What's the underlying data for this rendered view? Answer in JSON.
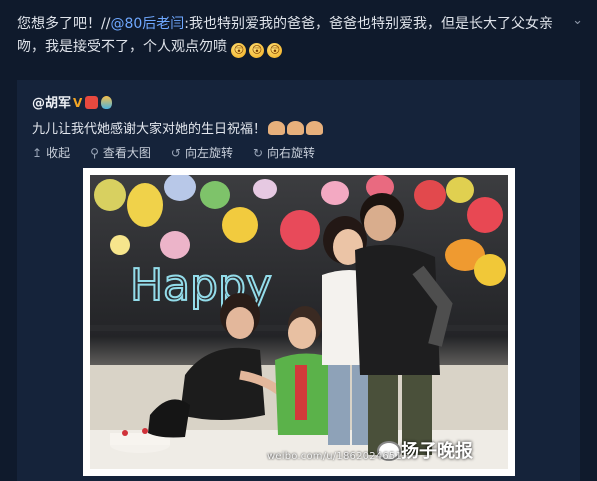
{
  "post": {
    "text_before": "您想多了吧！//",
    "mention": "@80后老闫",
    "text_after": ":我也特别爱我的爸爸，爸爸也特别爱我，但是长大了父女亲吻，我是接受不了，个人观点勿喷",
    "emojis": [
      "😲",
      "😲",
      "😲"
    ]
  },
  "repost": {
    "author": "@胡军",
    "verified_badge": "V",
    "text": "九儿让我代她感谢大家对她的生日祝福！",
    "actions": [
      {
        "icon": "collapse-icon",
        "label": "收起"
      },
      {
        "icon": "magnifier-icon",
        "label": "查看大图"
      },
      {
        "icon": "rotate-left-icon",
        "label": "向左旋转"
      },
      {
        "icon": "rotate-right-icon",
        "label": "向右旋转"
      }
    ]
  },
  "photo": {
    "balloon_text": "Happy",
    "watermark_url": "weibo.com/u/1862024651",
    "watermark_brand": "扬子晚报"
  },
  "colors": {
    "background": "#0f1a2c",
    "repost_panel": "#15233a",
    "mention": "#6fa8ff"
  }
}
